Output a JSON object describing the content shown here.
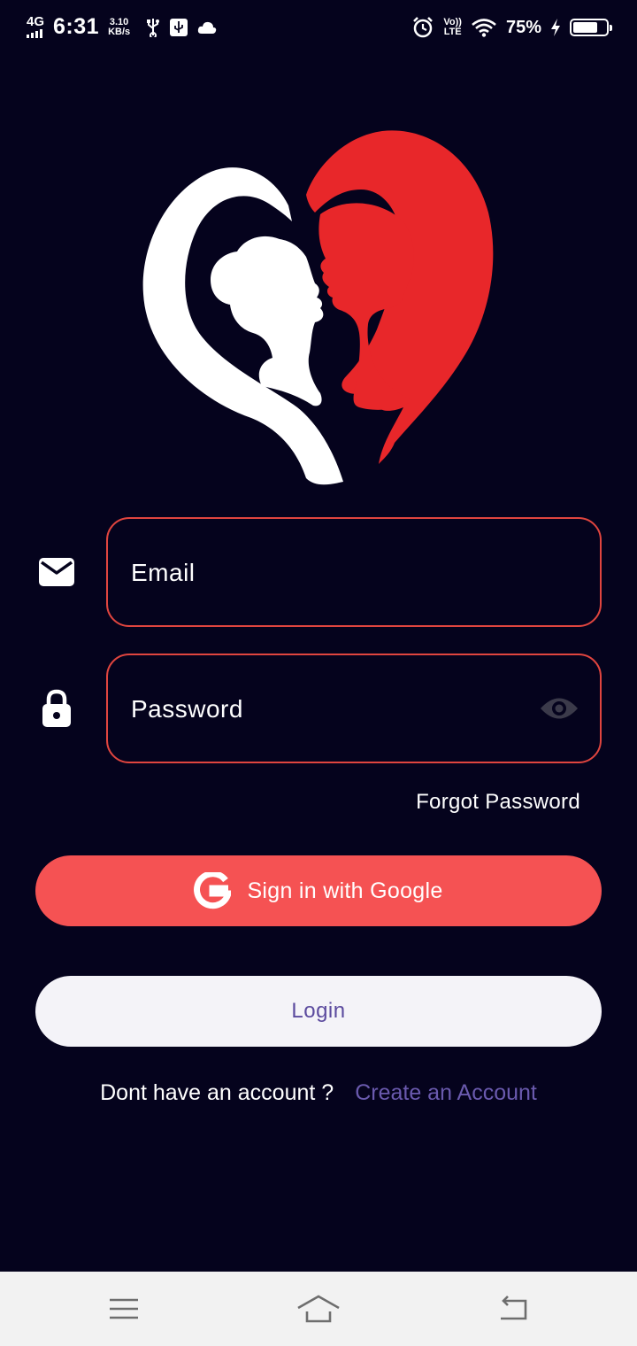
{
  "status_bar": {
    "network": "4G",
    "time": "6:31",
    "speed_value": "3.10",
    "speed_unit": "KB/s",
    "volte_top": "Vo))",
    "volte_bottom": "LTE",
    "battery_percent": "75%",
    "battery_level": 0.75
  },
  "colors": {
    "background": "#05031d",
    "accent_red": "#f55253",
    "field_border": "#e0453f",
    "login_bg": "#f4f3f8",
    "link_purple": "#6a5aae",
    "logo_red": "#e8272a"
  },
  "form": {
    "email": {
      "placeholder": "Email",
      "value": "",
      "icon": "mail-icon"
    },
    "password": {
      "placeholder": "Password",
      "value": "",
      "icon": "lock-icon",
      "toggle_icon": "eye-icon"
    },
    "forgot_label": "Forgot Password"
  },
  "buttons": {
    "google_label": "Sign in with Google",
    "login_label": "Login"
  },
  "signup": {
    "question": "Dont have an account ?",
    "link": "Create an Account"
  },
  "nav_bar": {
    "items": [
      "menu-icon",
      "home-icon",
      "back-icon"
    ]
  }
}
